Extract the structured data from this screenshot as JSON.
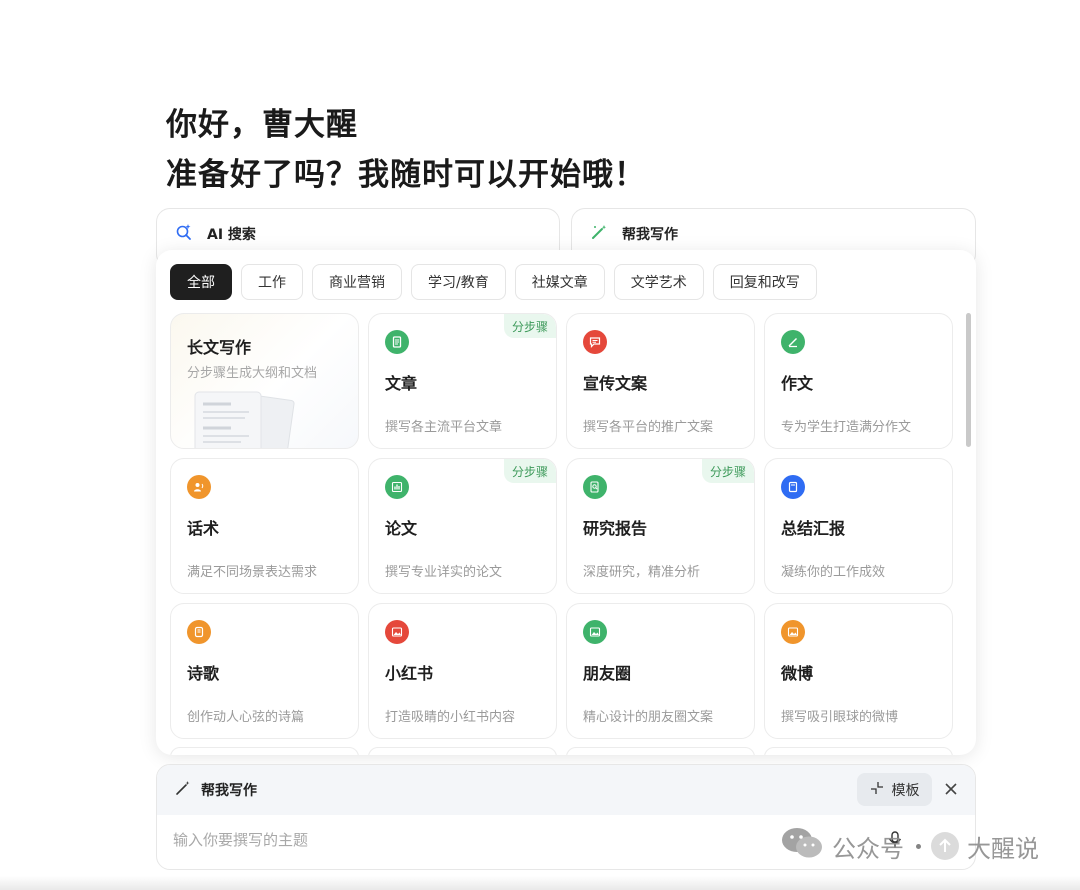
{
  "greeting": {
    "line1": "你好，曹大醒",
    "line2": "准备好了吗？我随时可以开始哦！"
  },
  "top_cards": {
    "ai_search": {
      "label": "AI 搜索",
      "icon": "search-sparkle-icon"
    },
    "help_write": {
      "label": "帮我写作",
      "icon": "magic-pen-icon"
    }
  },
  "tabs": [
    {
      "label": "全部",
      "active": true
    },
    {
      "label": "工作"
    },
    {
      "label": "商业营销"
    },
    {
      "label": "学习/教育"
    },
    {
      "label": "社媒文章"
    },
    {
      "label": "文学艺术"
    },
    {
      "label": "回复和改写"
    }
  ],
  "featured": {
    "title": "长文写作",
    "desc": "分步骤生成大纲和文档"
  },
  "cards": [
    {
      "title": "文章",
      "desc": "撰写各主流平台文章",
      "badge": "分步骤",
      "icon": "document-icon",
      "color": "#3fb36b"
    },
    {
      "title": "宣传文案",
      "desc": "撰写各平台的推广文案",
      "icon": "speech-bubble-icon",
      "color": "#e5483b"
    },
    {
      "title": "作文",
      "desc": "专为学生打造满分作文",
      "icon": "pencil-icon",
      "color": "#3fb36b"
    },
    {
      "title": "话术",
      "desc": "满足不同场景表达需求",
      "icon": "person-speaking-icon",
      "color": "#f0952c"
    },
    {
      "title": "论文",
      "desc": "撰写专业详实的论文",
      "badge": "分步骤",
      "icon": "bar-chart-icon",
      "color": "#3fb36b"
    },
    {
      "title": "研究报告",
      "desc": "深度研究，精准分析",
      "badge": "分步骤",
      "icon": "report-search-icon",
      "color": "#3fb36b"
    },
    {
      "title": "总结汇报",
      "desc": "凝练你的工作成效",
      "icon": "book-icon",
      "color": "#2f6cf3"
    },
    {
      "title": "诗歌",
      "desc": "创作动人心弦的诗篇",
      "icon": "scroll-icon",
      "color": "#f0952c"
    },
    {
      "title": "小红书",
      "desc": "打造吸睛的小红书内容",
      "icon": "image-icon",
      "color": "#e5483b"
    },
    {
      "title": "朋友圈",
      "desc": "精心设计的朋友圈文案",
      "icon": "image-icon",
      "color": "#3fb36b"
    },
    {
      "title": "微博",
      "desc": "撰写吸引眼球的微博",
      "icon": "image-icon",
      "color": "#f0952c"
    }
  ],
  "composer": {
    "mode_label": "帮我写作",
    "template_label": "模板",
    "placeholder": "输入你要撰写的主题"
  },
  "watermark": {
    "left": "公众号",
    "right": "大醒说"
  }
}
